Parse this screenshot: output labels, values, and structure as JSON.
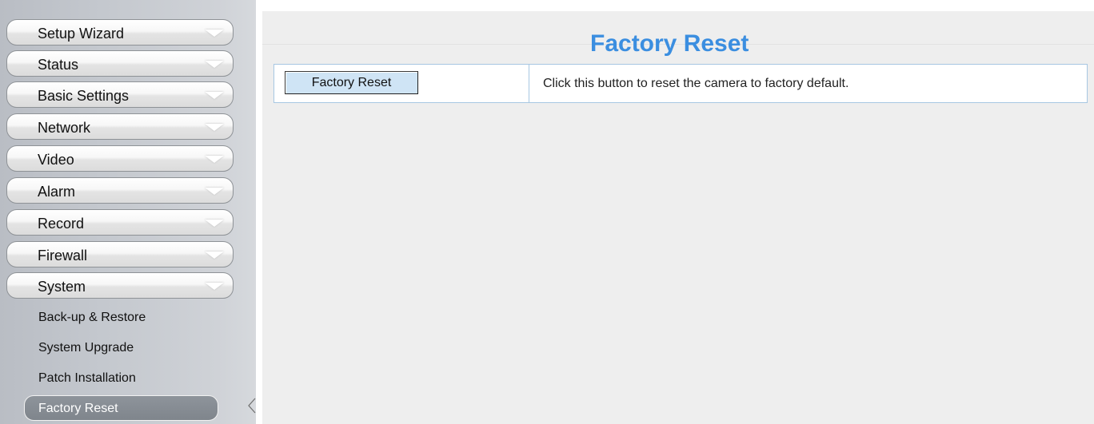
{
  "sidebar": {
    "menu": [
      {
        "label": "Setup Wizard"
      },
      {
        "label": "Status"
      },
      {
        "label": "Basic Settings"
      },
      {
        "label": "Network"
      },
      {
        "label": "Video"
      },
      {
        "label": "Alarm"
      },
      {
        "label": "Record"
      },
      {
        "label": "Firewall"
      },
      {
        "label": "System"
      }
    ],
    "submenu": [
      {
        "label": "Back-up & Restore"
      },
      {
        "label": "System Upgrade"
      },
      {
        "label": "Patch Installation"
      },
      {
        "label": "Factory Reset",
        "active": true
      }
    ]
  },
  "main": {
    "title": "Factory Reset",
    "button_label": "Factory Reset",
    "description": "Click this button to reset the camera to factory default."
  },
  "colors": {
    "title": "#3b8ee0",
    "button_bg": "#cfe4f5",
    "row_border": "#a7c7e2",
    "active_item_bg": "#7f858c"
  }
}
